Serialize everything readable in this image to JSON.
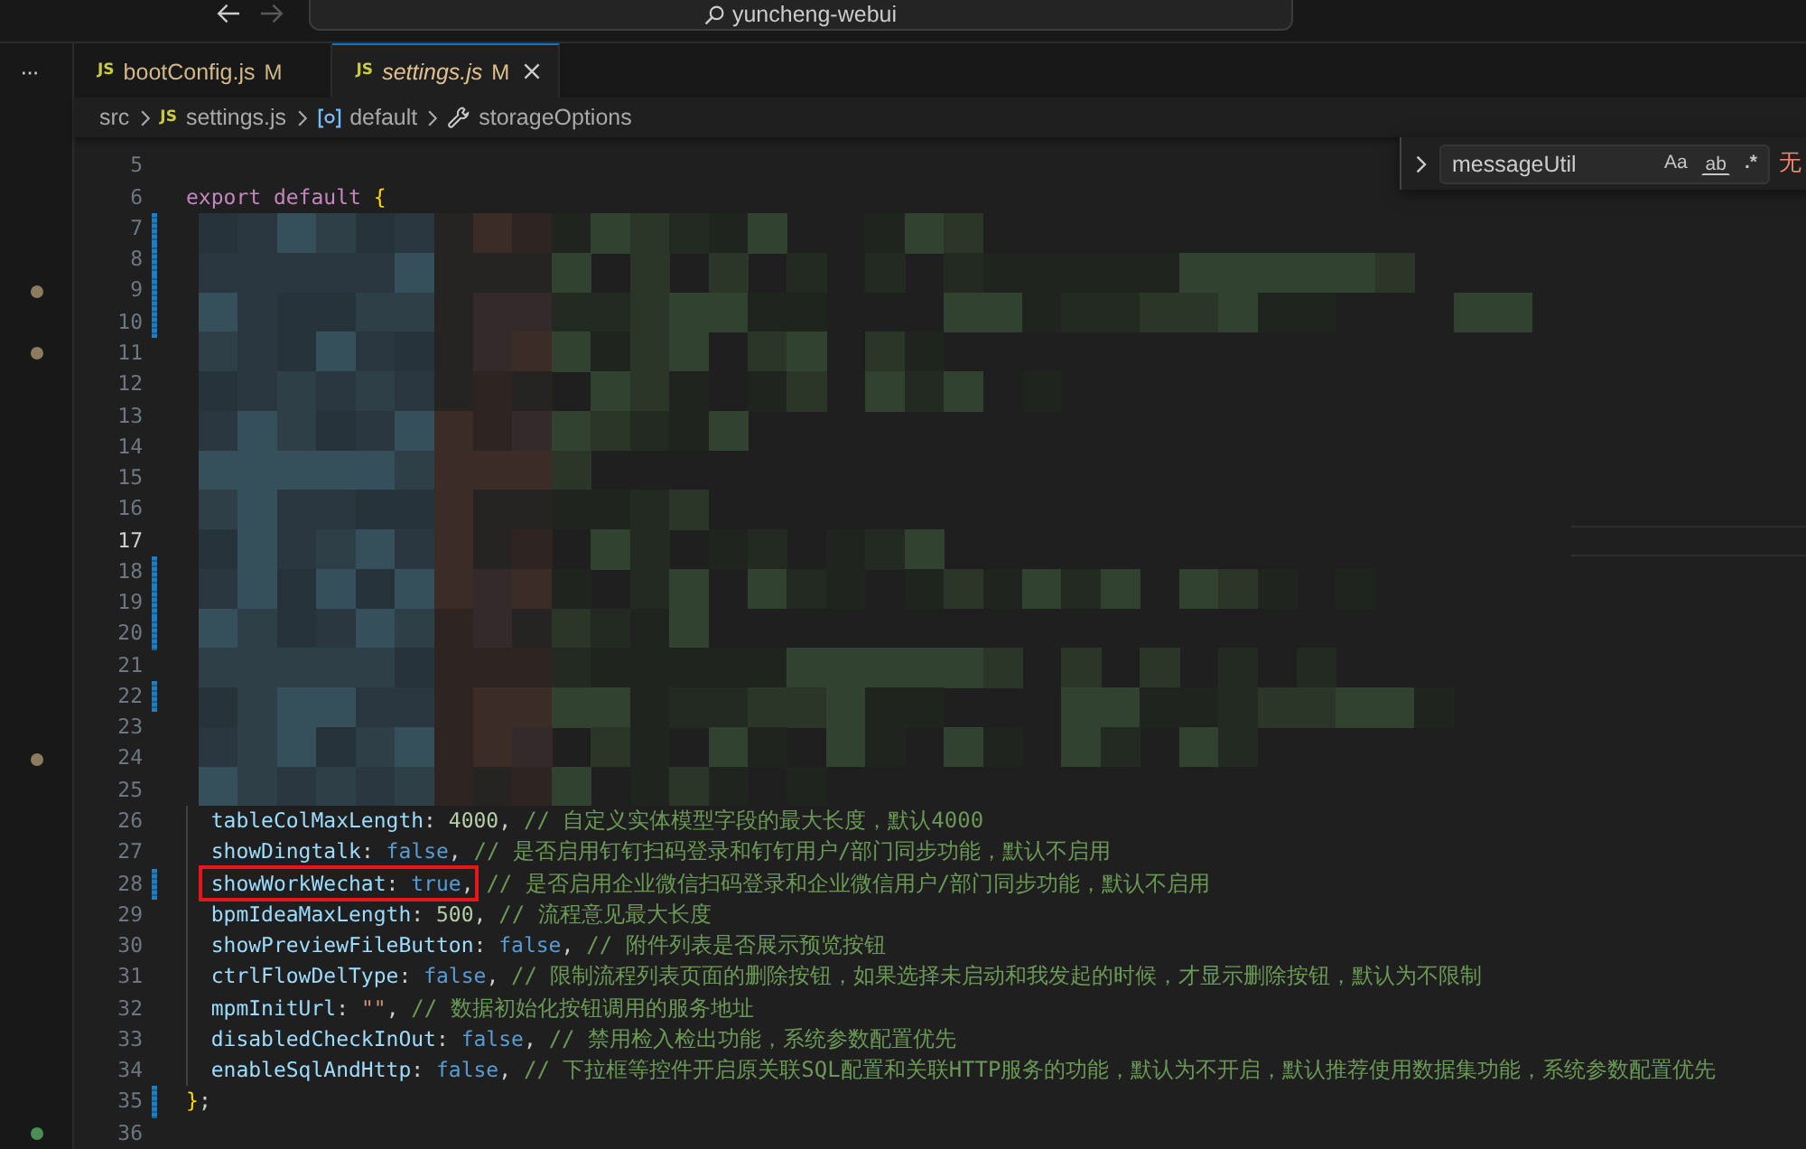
{
  "title_bar": {
    "back": {
      "disabled": false
    },
    "forward": {
      "disabled": true
    },
    "command_center": {
      "label": "yuncheng-webui"
    }
  },
  "side_strip": {
    "more": "···"
  },
  "tabs": [
    {
      "icon": "JS",
      "label": "bootConfig.js",
      "status": "M",
      "selected": false,
      "preview": false
    },
    {
      "icon": "JS",
      "label": "settings.js",
      "status": "M",
      "selected": true,
      "preview": true
    }
  ],
  "breadcrumb": [
    {
      "kind": "folder",
      "label": "src"
    },
    {
      "kind": "file",
      "icon": "JS",
      "label": "settings.js"
    },
    {
      "kind": "variable",
      "label": "default"
    },
    {
      "kind": "property",
      "label": "storageOptions"
    }
  ],
  "find_widget": {
    "value": "messageUtil",
    "options": [
      {
        "kind": "case",
        "label": "Aa",
        "on": false
      },
      {
        "kind": "word",
        "label": "ab",
        "on": false
      },
      {
        "kind": "regex",
        "label": ".*",
        "on": false
      }
    ],
    "result": "无"
  },
  "lines": [
    {
      "number": "5",
      "kind": "code",
      "modified": false,
      "current": false,
      "boxed": false
    },
    {
      "number": "6",
      "kind": "code",
      "modified": false,
      "current": false,
      "boxed": false,
      "tokens": [
        {
          "kind": "keyword",
          "text": "export default "
        },
        {
          "kind": "bracket",
          "text": "{"
        }
      ]
    },
    {
      "number": "7",
      "kind": "pixelated",
      "modified": true,
      "current": false,
      "boxed": false
    },
    {
      "number": "8",
      "kind": "pixelated",
      "modified": true,
      "current": false,
      "boxed": false
    },
    {
      "number": "9",
      "kind": "pixelated",
      "modified": true,
      "current": false,
      "boxed": false,
      "color": "#8c7b5e"
    },
    {
      "number": "10",
      "kind": "pixelated",
      "modified": true,
      "current": false,
      "boxed": false
    },
    {
      "number": "11",
      "kind": "pixelated",
      "modified": false,
      "current": false,
      "boxed": false,
      "color": "#8c7b5e"
    },
    {
      "number": "12",
      "kind": "pixelated",
      "modified": false,
      "current": false,
      "boxed": false
    },
    {
      "number": "13",
      "kind": "pixelated",
      "modified": false,
      "current": false,
      "boxed": false
    },
    {
      "number": "14",
      "kind": "pixelated",
      "modified": false,
      "current": false,
      "boxed": false
    },
    {
      "number": "15",
      "kind": "pixelated",
      "modified": false,
      "current": false,
      "boxed": false
    },
    {
      "number": "16",
      "kind": "pixelated",
      "modified": false,
      "current": false,
      "boxed": false
    },
    {
      "number": "17",
      "kind": "pixelated",
      "modified": false,
      "current": true,
      "boxed": false
    },
    {
      "number": "18",
      "kind": "pixelated",
      "modified": true,
      "current": false,
      "boxed": false
    },
    {
      "number": "19",
      "kind": "pixelated",
      "modified": true,
      "current": false,
      "boxed": false
    },
    {
      "number": "20",
      "kind": "pixelated",
      "modified": true,
      "current": false,
      "boxed": false
    },
    {
      "number": "21",
      "kind": "pixelated",
      "modified": false,
      "current": false,
      "boxed": false
    },
    {
      "number": "22",
      "kind": "pixelated",
      "modified": true,
      "current": false,
      "boxed": false
    },
    {
      "number": "23",
      "kind": "pixelated",
      "modified": false,
      "current": false,
      "boxed": false
    },
    {
      "number": "24",
      "kind": "pixelated",
      "modified": false,
      "current": false,
      "boxed": false,
      "color": "#8c7b5e"
    },
    {
      "number": "25",
      "kind": "pixelated",
      "modified": false,
      "current": false,
      "boxed": false
    },
    {
      "number": "26",
      "kind": "member",
      "modified": false,
      "current": false,
      "boxed": false,
      "tokens": [
        {
          "kind": "key",
          "text": "tableColMaxLength"
        },
        {
          "kind": "punct",
          "text": ": "
        },
        {
          "kind": "number",
          "text": "4000"
        },
        {
          "kind": "punct",
          "text": ", "
        },
        {
          "kind": "comment",
          "text": "// 自定义实体模型字段的最大长度，默认4000"
        }
      ]
    },
    {
      "number": "27",
      "kind": "member",
      "modified": false,
      "current": false,
      "boxed": false,
      "tokens": [
        {
          "kind": "key",
          "text": "showDingtalk"
        },
        {
          "kind": "punct",
          "text": ": "
        },
        {
          "kind": "bool",
          "text": "false"
        },
        {
          "kind": "punct",
          "text": ", "
        },
        {
          "kind": "comment",
          "text": "// 是否启用钉钉扫码登录和钉钉用户/部门同步功能，默认不启用"
        }
      ]
    },
    {
      "number": "28",
      "kind": "member",
      "modified": true,
      "current": false,
      "boxed": true,
      "tokens": [
        {
          "kind": "key",
          "text": "showWorkWechat"
        },
        {
          "kind": "punct",
          "text": ": "
        },
        {
          "kind": "bool",
          "text": "true"
        },
        {
          "kind": "punct",
          "text": ", "
        },
        {
          "kind": "comment",
          "text": "// 是否启用企业微信扫码登录和企业微信用户/部门同步功能，默认不启用"
        }
      ]
    },
    {
      "number": "29",
      "kind": "member",
      "modified": false,
      "current": false,
      "boxed": false,
      "tokens": [
        {
          "kind": "key",
          "text": "bpmIdeaMaxLength"
        },
        {
          "kind": "punct",
          "text": ": "
        },
        {
          "kind": "number",
          "text": "500"
        },
        {
          "kind": "punct",
          "text": ", "
        },
        {
          "kind": "comment",
          "text": "// 流程意见最大长度"
        }
      ]
    },
    {
      "number": "30",
      "kind": "member",
      "modified": false,
      "current": false,
      "boxed": false,
      "tokens": [
        {
          "kind": "key",
          "text": "showPreviewFileButton"
        },
        {
          "kind": "punct",
          "text": ": "
        },
        {
          "kind": "bool",
          "text": "false"
        },
        {
          "kind": "punct",
          "text": ", "
        },
        {
          "kind": "comment",
          "text": "// 附件列表是否展示预览按钮"
        }
      ]
    },
    {
      "number": "31",
      "kind": "member",
      "modified": false,
      "current": false,
      "boxed": false,
      "tokens": [
        {
          "kind": "key",
          "text": "ctrlFlowDelType"
        },
        {
          "kind": "punct",
          "text": ": "
        },
        {
          "kind": "bool",
          "text": "false"
        },
        {
          "kind": "punct",
          "text": ", "
        },
        {
          "kind": "comment",
          "text": "// 限制流程列表页面的删除按钮，如果选择未启动和我发起的时候，才显示删除按钮，默认为不限制"
        }
      ]
    },
    {
      "number": "32",
      "kind": "member",
      "modified": false,
      "current": false,
      "boxed": false,
      "tokens": [
        {
          "kind": "key",
          "text": "mpmInitUrl"
        },
        {
          "kind": "punct",
          "text": ": "
        },
        {
          "kind": "string",
          "text": "\"\""
        },
        {
          "kind": "punct",
          "text": ", "
        },
        {
          "kind": "comment",
          "text": "// 数据初始化按钮调用的服务地址"
        }
      ]
    },
    {
      "number": "33",
      "kind": "member",
      "modified": false,
      "current": false,
      "boxed": false,
      "tokens": [
        {
          "kind": "key",
          "text": "disabledCheckInOut"
        },
        {
          "kind": "punct",
          "text": ": "
        },
        {
          "kind": "bool",
          "text": "false"
        },
        {
          "kind": "punct",
          "text": ", "
        },
        {
          "kind": "comment",
          "text": "// 禁用检入检出功能，系统参数配置优先"
        }
      ]
    },
    {
      "number": "34",
      "kind": "member",
      "modified": false,
      "current": false,
      "boxed": false,
      "tokens": [
        {
          "kind": "key",
          "text": "enableSqlAndHttp"
        },
        {
          "kind": "punct",
          "text": ": "
        },
        {
          "kind": "bool",
          "text": "false"
        },
        {
          "kind": "punct",
          "text": ", "
        },
        {
          "kind": "comment",
          "text": "// 下拉框等控件开启原关联SQL配置和关联HTTP服务的功能，默认为不开启，默认推荐使用数据集功能，系统参数配置优先"
        }
      ]
    },
    {
      "number": "35",
      "kind": "code",
      "modified": true,
      "current": false,
      "boxed": false,
      "tokens": [
        {
          "kind": "bracket",
          "text": "}"
        },
        {
          "kind": "punct",
          "text": ";"
        }
      ]
    },
    {
      "number": "36",
      "kind": "code",
      "modified": false,
      "current": false,
      "boxed": false,
      "color": "#4b8f55"
    }
  ]
}
